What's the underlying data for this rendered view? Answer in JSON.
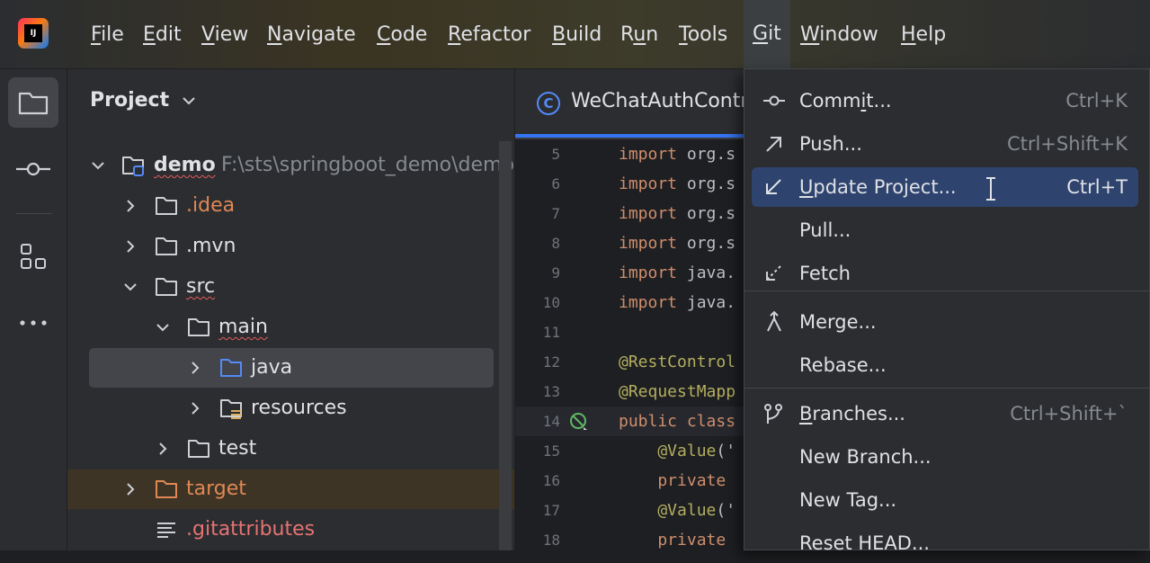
{
  "menubar": {
    "logo_text": "IJ",
    "items": [
      {
        "pre": "",
        "mn": "F",
        "post": "ile"
      },
      {
        "pre": "",
        "mn": "E",
        "post": "dit"
      },
      {
        "pre": "",
        "mn": "V",
        "post": "iew"
      },
      {
        "pre": "",
        "mn": "N",
        "post": "avigate"
      },
      {
        "pre": "",
        "mn": "C",
        "post": "ode"
      },
      {
        "pre": "",
        "mn": "R",
        "post": "efactor"
      },
      {
        "pre": "",
        "mn": "B",
        "post": "uild"
      },
      {
        "pre": "R",
        "mn": "u",
        "post": "n"
      },
      {
        "pre": "",
        "mn": "T",
        "post": "ools"
      },
      {
        "pre": "",
        "mn": "G",
        "post": "it"
      },
      {
        "pre": "",
        "mn": "W",
        "post": "indow"
      },
      {
        "pre": "",
        "mn": "H",
        "post": "elp"
      }
    ]
  },
  "toolstrip": {
    "buttons": [
      "project-folder-icon",
      "commit-icon",
      "structure-icon",
      "more-icon"
    ]
  },
  "project": {
    "title": "Project",
    "tree": [
      {
        "name": "demo",
        "path": "F:\\sts\\springboot_demo\\demo",
        "expanded": true
      },
      {
        "name": ".idea",
        "color": "#e08855"
      },
      {
        "name": ".mvn"
      },
      {
        "name": "src",
        "expanded": true
      },
      {
        "name": "main",
        "expanded": true
      },
      {
        "name": "java",
        "selected": true
      },
      {
        "name": "resources"
      },
      {
        "name": "test"
      },
      {
        "name": "target",
        "color": "#e08855"
      },
      {
        "name": ".gitattributes",
        "color": "#e57373"
      }
    ]
  },
  "editor": {
    "tab_title": "WeChatAuthContr",
    "tab_icon_letter": "C",
    "lines": [
      {
        "n": "5",
        "parts": [
          [
            "kw",
            "import"
          ],
          [
            "id",
            " org.s"
          ]
        ]
      },
      {
        "n": "6",
        "parts": [
          [
            "kw",
            "import"
          ],
          [
            "id",
            " org.s"
          ]
        ]
      },
      {
        "n": "7",
        "parts": [
          [
            "kw",
            "import"
          ],
          [
            "id",
            " org.s"
          ]
        ]
      },
      {
        "n": "8",
        "parts": [
          [
            "kw",
            "import"
          ],
          [
            "id",
            " org.s"
          ]
        ]
      },
      {
        "n": "9",
        "parts": [
          [
            "kw",
            "import"
          ],
          [
            "id",
            " java."
          ]
        ]
      },
      {
        "n": "10",
        "parts": [
          [
            "kw",
            "import"
          ],
          [
            "id",
            " java."
          ]
        ]
      },
      {
        "n": "11",
        "parts": []
      },
      {
        "n": "12",
        "parts": [
          [
            "ann",
            "@RestControl"
          ]
        ]
      },
      {
        "n": "13",
        "parts": [
          [
            "ann",
            "@RequestMapp"
          ]
        ]
      },
      {
        "n": "14",
        "parts": [
          [
            "kw",
            "public class"
          ]
        ]
      },
      {
        "n": "15",
        "parts": [
          [
            "ann",
            "    @Value"
          ],
          [
            "id",
            "('"
          ]
        ]
      },
      {
        "n": "16",
        "parts": [
          [
            "kw",
            "    private"
          ]
        ]
      },
      {
        "n": "17",
        "parts": [
          [
            "ann",
            "    @Value"
          ],
          [
            "id",
            "('"
          ]
        ]
      },
      {
        "n": "18",
        "parts": [
          [
            "kw",
            "    private"
          ]
        ]
      }
    ]
  },
  "git_menu": {
    "items": [
      {
        "icon": "commit-icon",
        "pre": "Comm",
        "mn": "i",
        "post": "t...",
        "shortcut": "Ctrl+K"
      },
      {
        "icon": "push-icon",
        "pre": "",
        "mn": "",
        "post": "Push...",
        "shortcut": "Ctrl+Shift+K"
      },
      {
        "icon": "update-project-icon",
        "pre": "",
        "mn": "U",
        "post": "pdate Project...",
        "shortcut": "Ctrl+T",
        "highlighted": true
      },
      {
        "icon": "",
        "pre": "",
        "mn": "",
        "post": "Pull...",
        "shortcut": ""
      },
      {
        "icon": "fetch-icon",
        "pre": "",
        "mn": "",
        "post": "Fetch",
        "shortcut": ""
      },
      {
        "icon": "merge-icon",
        "pre": "",
        "mn": "",
        "post": "Merge...",
        "shortcut": ""
      },
      {
        "icon": "",
        "pre": "",
        "mn": "",
        "post": "Rebase...",
        "shortcut": ""
      },
      {
        "icon": "branches-icon",
        "pre": "",
        "mn": "B",
        "post": "ranches...",
        "shortcut": "Ctrl+Shift+`"
      },
      {
        "icon": "",
        "pre": "",
        "mn": "",
        "post": "New Branch...",
        "shortcut": ""
      },
      {
        "icon": "",
        "pre": "",
        "mn": "",
        "post": "New Tag...",
        "shortcut": ""
      },
      {
        "icon": "",
        "pre": "",
        "mn": "",
        "post": "Reset HEAD...",
        "shortcut": ""
      }
    ]
  }
}
